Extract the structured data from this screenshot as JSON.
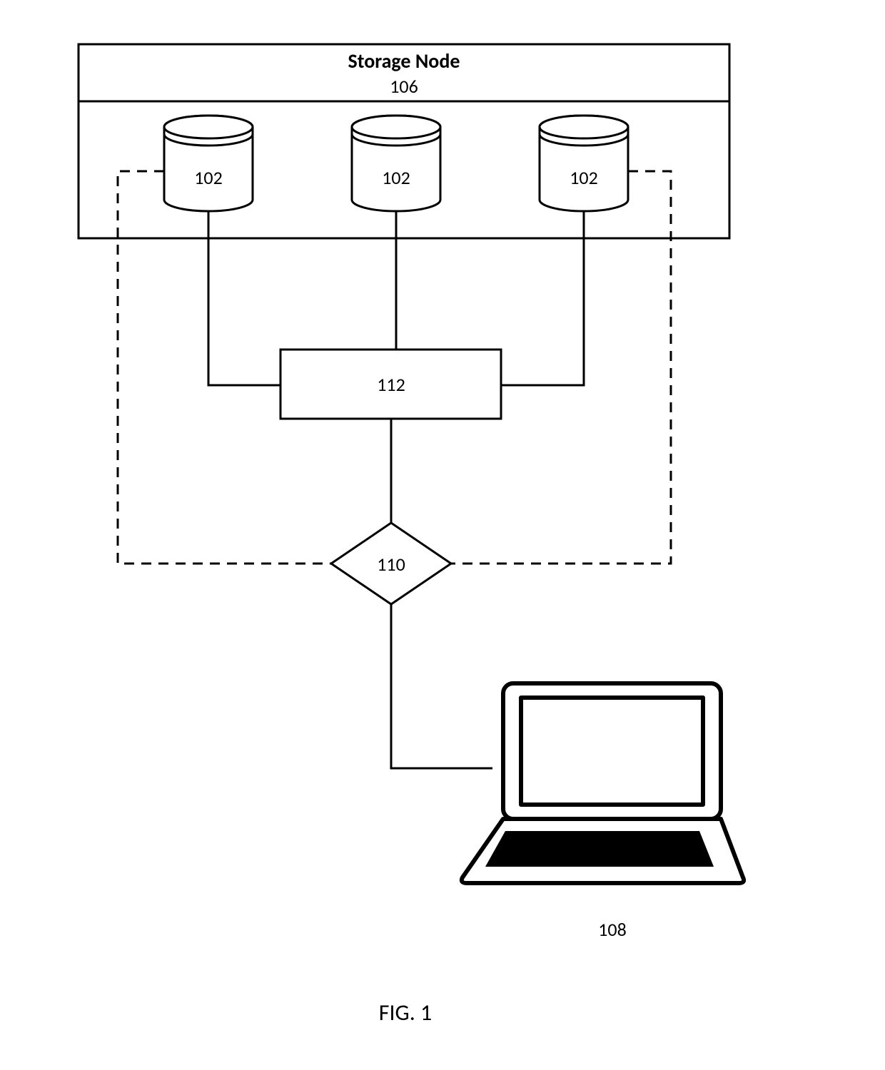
{
  "storage_node": {
    "title": "Storage Node",
    "id": "106"
  },
  "disks": [
    {
      "id": "102"
    },
    {
      "id": "102"
    },
    {
      "id": "102"
    }
  ],
  "box_112": {
    "id": "112"
  },
  "diamond_110": {
    "id": "110"
  },
  "laptop": {
    "id": "108"
  },
  "figure_label": "FIG. 1"
}
